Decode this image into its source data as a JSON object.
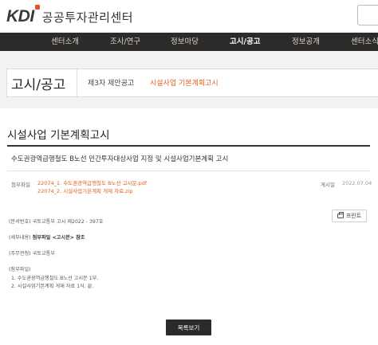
{
  "header": {
    "logo_mark": "KDI",
    "org_name": "공공투자관리센터"
  },
  "nav": {
    "items": [
      {
        "label": "센터소개"
      },
      {
        "label": "조사/연구"
      },
      {
        "label": "정보마당"
      },
      {
        "label": "고시/공고"
      },
      {
        "label": "정보공개"
      },
      {
        "label": "센터소식"
      }
    ],
    "active": "고시/공고"
  },
  "section": {
    "title": "고시/공고",
    "sub_tabs": [
      {
        "label": "제3자 제안공고"
      },
      {
        "label": "시설사업 기본계획고시"
      }
    ]
  },
  "post": {
    "page_heading": "시설사업 기본계획고시",
    "subject": "수도권광역급행철도 B노선 민간투자대상사업 지정 및 시설사업기본계획 고시",
    "attach_label": "첨부파일",
    "attachments": [
      "22074_1. 수도권광역급행철도 B노선 고시문.pdf",
      "22074_2. 시설사업기본계획 게재 자료.zip"
    ],
    "date_label": "게시일",
    "date": "2022.07.04",
    "print_label": "프린트",
    "body": {
      "doc_no_label": "(문서번호)",
      "doc_no_value": "국토교통부 고시 제2022 - 397호",
      "detail_label": "(세부내용)",
      "detail_value": "첨부파일 <고시문> 참조",
      "dept_label": "(주무관청)",
      "dept_value": "국토교통부",
      "attach_heading": "(첨부파일)",
      "attach_items": [
        "1. 수도권광역급행철도 B노선 고시문 1부.",
        "2. 시설사업기본계획 게재 자료 1식.  끝."
      ]
    },
    "list_button": "목록보기"
  },
  "colors": {
    "accent": "#e0611b",
    "nav_bg": "#2d2b29"
  }
}
